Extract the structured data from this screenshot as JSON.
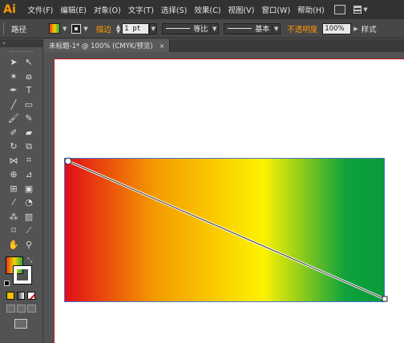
{
  "app": {
    "logo": "Ai",
    "accent": "#ff9a00"
  },
  "menu": {
    "items": [
      "文件(F)",
      "编辑(E)",
      "对象(O)",
      "文字(T)",
      "选择(S)",
      "效果(C)",
      "视图(V)",
      "窗口(W)",
      "帮助(H)"
    ]
  },
  "control": {
    "selection_label": "路径",
    "stroke_label": "描边",
    "stroke_weight": "1 pt",
    "profile1_label": "等比",
    "profile2_label": "基本",
    "opacity_label": "不透明度",
    "opacity_value": "100%",
    "style_label": "样式"
  },
  "document": {
    "tab_title": "未标题-1* @ 100% (CMYK/预览)",
    "close_glyph": "×"
  },
  "tools": {
    "panel_glyph": "«",
    "icons": [
      "selection-tool",
      "direct-selection-tool",
      "magic-wand-tool",
      "lasso-tool",
      "pen-tool",
      "type-tool",
      "line-tool",
      "rectangle-tool",
      "paintbrush-tool",
      "pencil-tool",
      "blob-brush-tool",
      "eraser-tool",
      "rotate-tool",
      "scale-tool",
      "width-tool",
      "free-transform-tool",
      "shape-builder-tool",
      "perspective-grid-tool",
      "mesh-tool",
      "gradient-tool",
      "eyedropper-tool",
      "blend-tool",
      "symbol-sprayer-tool",
      "column-graph-tool",
      "artboard-tool",
      "slice-tool",
      "hand-tool",
      "zoom-tool"
    ]
  },
  "artwork": {
    "gradient_colors": [
      "#e10d17",
      "#f39a00",
      "#fff200",
      "#0ea13c"
    ],
    "selection_color": "#4c6fd8"
  }
}
